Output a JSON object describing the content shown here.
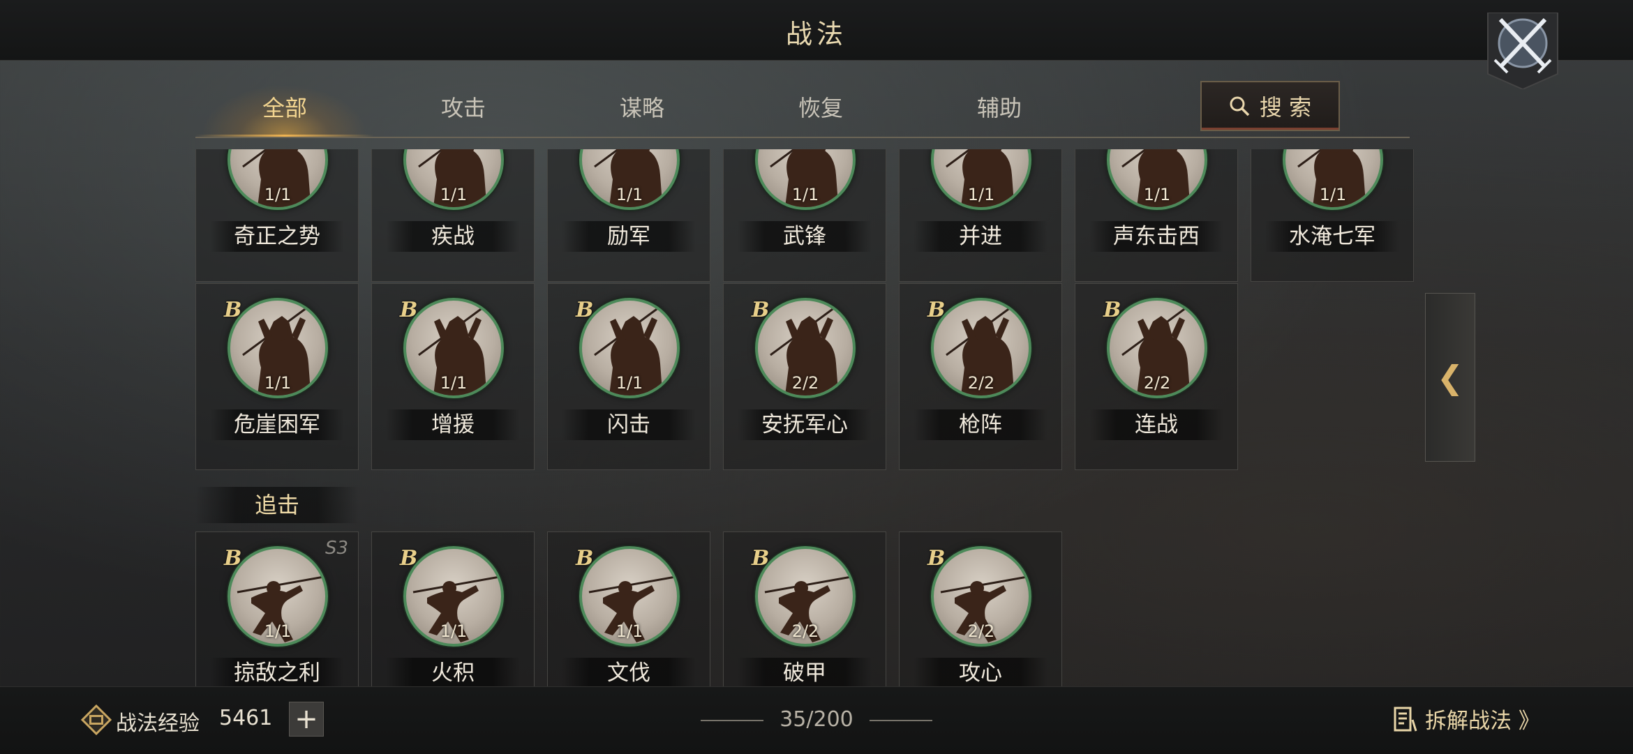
{
  "header": {
    "title": "战法"
  },
  "tabs": [
    {
      "label": "全部",
      "active": true
    },
    {
      "label": "攻击",
      "active": false
    },
    {
      "label": "谋略",
      "active": false
    },
    {
      "label": "恢复",
      "active": false
    },
    {
      "label": "辅助",
      "active": false
    }
  ],
  "search": {
    "label": "搜 索"
  },
  "row1": [
    {
      "name": "奇正之势",
      "count": "1/1"
    },
    {
      "name": "疾战",
      "count": "1/1"
    },
    {
      "name": "励军",
      "count": "1/1"
    },
    {
      "name": "武锋",
      "count": "1/1"
    },
    {
      "name": "并进",
      "count": "1/1"
    },
    {
      "name": "声东击西",
      "count": "1/1"
    },
    {
      "name": "水淹七军",
      "count": "1/1"
    }
  ],
  "row2": [
    {
      "grade": "B",
      "name": "危崖困军",
      "count": "1/1"
    },
    {
      "grade": "B",
      "name": "增援",
      "count": "1/1"
    },
    {
      "grade": "B",
      "name": "闪击",
      "count": "1/1"
    },
    {
      "grade": "B",
      "name": "安抚军心",
      "count": "2/2"
    },
    {
      "grade": "B",
      "name": "枪阵",
      "count": "2/2"
    },
    {
      "grade": "B",
      "name": "连战",
      "count": "2/2"
    }
  ],
  "section": {
    "label": "追击"
  },
  "row3": [
    {
      "grade": "B",
      "season": "S3",
      "name": "掠敌之利",
      "count": "1/1"
    },
    {
      "grade": "B",
      "name": "火积",
      "count": "1/1"
    },
    {
      "grade": "B",
      "name": "文伐",
      "count": "1/1"
    },
    {
      "grade": "B",
      "name": "破甲",
      "count": "2/2"
    },
    {
      "grade": "B",
      "name": "攻心",
      "count": "2/2"
    }
  ],
  "side_toggle": {
    "glyph": "❮"
  },
  "footer": {
    "exp_label": "战法经验",
    "exp_value": "5461",
    "add_label": "+",
    "capacity": "35/200",
    "decompose_label": "拆解战法 》"
  },
  "colors": {
    "accent": "#f3d590",
    "ring": "#4d8a5a",
    "grade": "#e8cf8a"
  },
  "icons": [
    "crossed-swords-icon",
    "search-icon",
    "chevron-left-icon",
    "exp-badge-icon",
    "list-icon"
  ]
}
